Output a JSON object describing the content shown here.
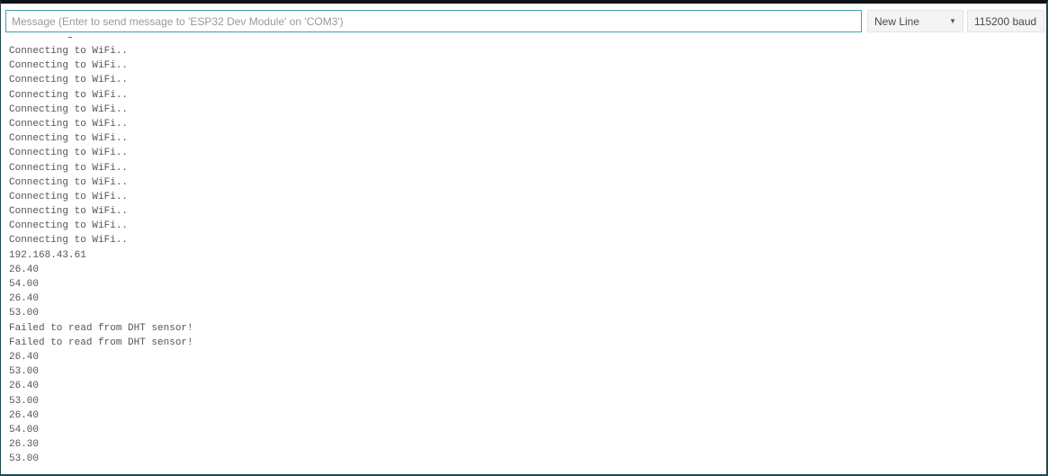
{
  "toolbar": {
    "message_placeholder": "Message (Enter to send message to 'ESP32 Dev Module' on 'COM3')",
    "line_ending_selected": "New Line",
    "baud_selected": "115200 baud"
  },
  "icons": {
    "dropdown": "chevron-down-icon"
  },
  "colors": {
    "input_border": "#3aa3a8",
    "window_border": "#1f4a4e",
    "output_text": "#555555"
  },
  "output": {
    "lines": [
      "Connecting to WiFi..",
      "Connecting to WiFi..",
      "Connecting to WiFi..",
      "Connecting to WiFi..",
      "Connecting to WiFi..",
      "Connecting to WiFi..",
      "Connecting to WiFi..",
      "Connecting to WiFi..",
      "Connecting to WiFi..",
      "Connecting to WiFi..",
      "Connecting to WiFi..",
      "Connecting to WiFi..",
      "Connecting to WiFi..",
      "Connecting to WiFi..",
      "192.168.43.61",
      "26.40",
      "54.00",
      "26.40",
      "53.00",
      "Failed to read from DHT sensor!",
      "Failed to read from DHT sensor!",
      "26.40",
      "53.00",
      "26.40",
      "53.00",
      "26.40",
      "54.00",
      "26.30",
      "53.00"
    ]
  }
}
